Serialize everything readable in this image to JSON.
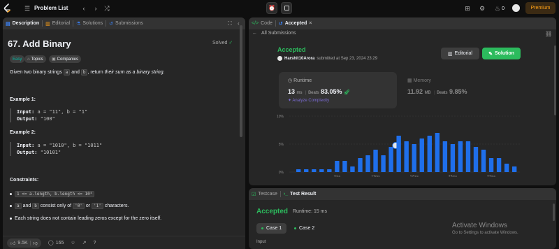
{
  "topbar": {
    "title": "Problem List",
    "premium": "Premium",
    "streak_count": "0",
    "icons": [
      "leetcode-logo",
      "list-icon",
      "chevron-left-icon",
      "chevron-right-icon",
      "shuffle-icon",
      "alarm-icon",
      "notes-icon",
      "grid-icon",
      "settings-icon",
      "fire-icon",
      "avatar"
    ]
  },
  "left_panel": {
    "tabs": [
      "Description",
      "Editorial",
      "Solutions",
      "Submissions"
    ],
    "title": "67. Add Binary",
    "status": "Solved",
    "chips": [
      "Easy",
      "Topics",
      "Companies"
    ],
    "description": {
      "p1": "Given two binary strings ",
      "a": "a",
      "p2": " and ",
      "b": "b",
      "p3": ", return ",
      "em": "their sum as a binary string",
      "p4": "."
    },
    "examples": [
      {
        "heading": "Example 1:",
        "input_label": "Input:",
        "input": "a = \"11\", b = \"1\"",
        "output_label": "Output:",
        "output": "\"100\""
      },
      {
        "heading": "Example 2:",
        "input_label": "Input:",
        "input": "a = \"1010\", b = \"1011\"",
        "output_label": "Output:",
        "output": "\"10101\""
      }
    ],
    "constraints_heading": "Constraints:",
    "constraints": {
      "c1_code": "1 <= a.length, b.length <= 10⁴",
      "c2_a": "a",
      "c2_mid": " and ",
      "c2_b": "b",
      "c2_text": " consist only of ",
      "c2_0": "'0'",
      "c2_or": " or ",
      "c2_1": "'1'",
      "c2_end": " characters.",
      "c3": "Each string does not contain leading zeros except for the zero itself."
    },
    "footer": {
      "likes": "9.5K",
      "comments": "165"
    }
  },
  "right_top": {
    "tabs": [
      "Code",
      "Accepted"
    ],
    "back_link": "All Submissions",
    "status": "Accepted",
    "user": "Harshit10Arora",
    "submitted_text": "submitted at Sep 23, 2024 23:29",
    "editorial_btn": "Editorial",
    "solution_btn": "Solution",
    "runtime": {
      "label": "Runtime",
      "value": "13",
      "unit": "ms",
      "beats_label": "Beats",
      "beats": "83.05%"
    },
    "analyze": "Analyze Complexity",
    "memory": {
      "label": "Memory",
      "value": "11.92",
      "unit": "MB",
      "beats_label": "Beats",
      "beats": "9.85%"
    }
  },
  "chart_data": {
    "type": "bar",
    "ylabel": "",
    "y_ticks": [
      "10%",
      "5%",
      "0%"
    ],
    "ylim": [
      0,
      10
    ],
    "x_ticks": [
      "7ms",
      "12ms",
      "17ms",
      "22ms",
      "27ms"
    ],
    "x": [
      1,
      2,
      3,
      4,
      5,
      6,
      7,
      8,
      9,
      10,
      11,
      12,
      13,
      14,
      15,
      16,
      17,
      18,
      19,
      20,
      21,
      22,
      23,
      24,
      25,
      26,
      27,
      28,
      29
    ],
    "values": [
      0.5,
      0.5,
      0.5,
      0.5,
      0.5,
      2.0,
      2.0,
      1.0,
      2.5,
      3.0,
      4.0,
      3.0,
      4.5,
      6.5,
      5.5,
      5.0,
      6.0,
      6.5,
      7.0,
      5.5,
      5.0,
      5.5,
      5.5,
      4.5,
      4.0,
      2.5,
      2.5,
      1.5,
      1.0
    ],
    "highlight_x": 13,
    "colors": {
      "bar": "#1f6feb",
      "grid": "#3a3a3a"
    }
  },
  "right_bottom": {
    "tabs": [
      "Testcase",
      "Test Result"
    ],
    "status": "Accepted",
    "runtime": "Runtime: 15 ms",
    "cases": [
      "Case 1",
      "Case 2"
    ],
    "input_label": "Input"
  },
  "watermark": {
    "title": "Activate Windows",
    "subtitle": "Go to Settings to activate Windows."
  },
  "colors": {
    "bg": "#0f0f0f",
    "panel": "#262626",
    "panel_head": "#333333",
    "green": "#2cbb5d",
    "orange": "#ffa116",
    "bar_blue": "#1f6feb"
  }
}
